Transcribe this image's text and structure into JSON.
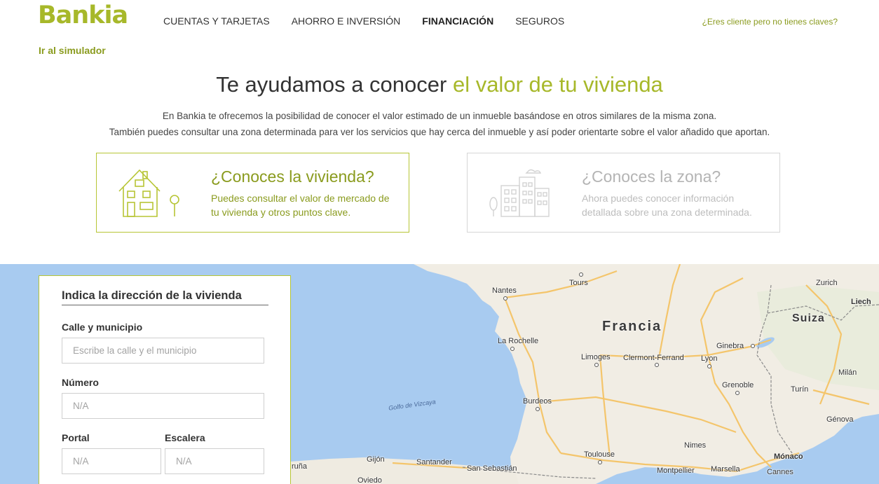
{
  "header": {
    "logo": "Bankia",
    "nav": [
      "CUENTAS Y TARJETAS",
      "AHORRO E INVERSIÓN",
      "FINANCIACIÓN",
      "SEGUROS"
    ],
    "client_link": "¿Eres cliente pero no tienes claves?",
    "simulator_link": "Ir al simulador"
  },
  "hero": {
    "title_part1": "Te ayudamos a conocer ",
    "title_accent": "el valor de tu vivienda",
    "desc_line1": "En Bankia te ofrecemos la posibilidad de conocer el valor estimado de un inmueble basándose en otros similares de la misma zona.",
    "desc_line2": "También puedes consultar una zona determinada para ver los servicios que hay cerca del inmueble y así poder orientarte sobre el valor añadido que aportan."
  },
  "cards": {
    "house": {
      "title": "¿Conoces la vivienda?",
      "text": "Puedes consultar el valor de mercado de tu vivienda y otros puntos clave.",
      "icon": "house-icon"
    },
    "zone": {
      "title": "¿Conoces la zona?",
      "text": "Ahora puedes conocer información detallada sobre una zona determinada.",
      "icon": "buildings-icon"
    }
  },
  "form": {
    "title": "Indica la dirección de la vivienda",
    "street_label": "Calle y municipio",
    "street_placeholder": "Escribe la calle y el municipio",
    "number_label": "Número",
    "number_placeholder": "N/A",
    "portal_label": "Portal",
    "portal_placeholder": "N/A",
    "stair_label": "Escalera",
    "stair_placeholder": "N/A"
  },
  "map": {
    "countries": [
      "Francia",
      "Suiza"
    ],
    "sea": "Golfo de Vizcaya",
    "cities": [
      "Nantes",
      "Tours",
      "Zurich",
      "Liech",
      "La Rochelle",
      "Ginebra",
      "Limoges",
      "Clermont-Ferrand",
      "Lyon",
      "Milán",
      "Grenoble",
      "Turín",
      "Burdeos",
      "Génova",
      "Nimes",
      "Toulouse",
      "Mónaco",
      "Gijón",
      "Santander",
      "San Sebastián",
      "Montpellier",
      "Marsella",
      "Cannes",
      "Oviedo",
      "ruña"
    ]
  },
  "colors": {
    "brand": "#a7b82a",
    "brand_dark": "#8a9b1e",
    "sea": "#a8cbf0",
    "land": "#f1ede4"
  }
}
